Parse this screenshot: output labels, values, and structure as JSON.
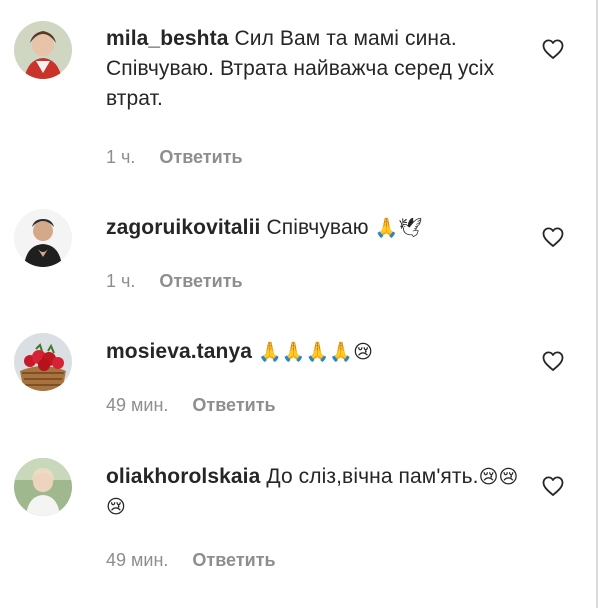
{
  "comments": [
    {
      "username": "mila_beshta",
      "text": "Сил Вам та мамі сина. Співчуваю. Втрата найважча серед усіх втрат.",
      "emoji": "",
      "time": "1 ч.",
      "reply_label": "Ответить"
    },
    {
      "username": "zagoruikovitalii",
      "text": "Співчуваю",
      "emoji": "🙏🕊",
      "time": "1 ч.",
      "reply_label": "Ответить"
    },
    {
      "username": "mosieva.tanya",
      "text": "",
      "emoji": "🙏🙏🙏🙏😢",
      "time": "49 мин.",
      "reply_label": "Ответить"
    },
    {
      "username": "oliakhorolskaia",
      "text": "До сліз,вічна пам'ять.",
      "emoji": "😢😢😢",
      "time": "49 мин.",
      "reply_label": "Ответить"
    }
  ],
  "colors": {
    "text": "#262626",
    "secondary": "#8e8e8e"
  },
  "icons": {
    "like": "heart-outline-icon"
  }
}
